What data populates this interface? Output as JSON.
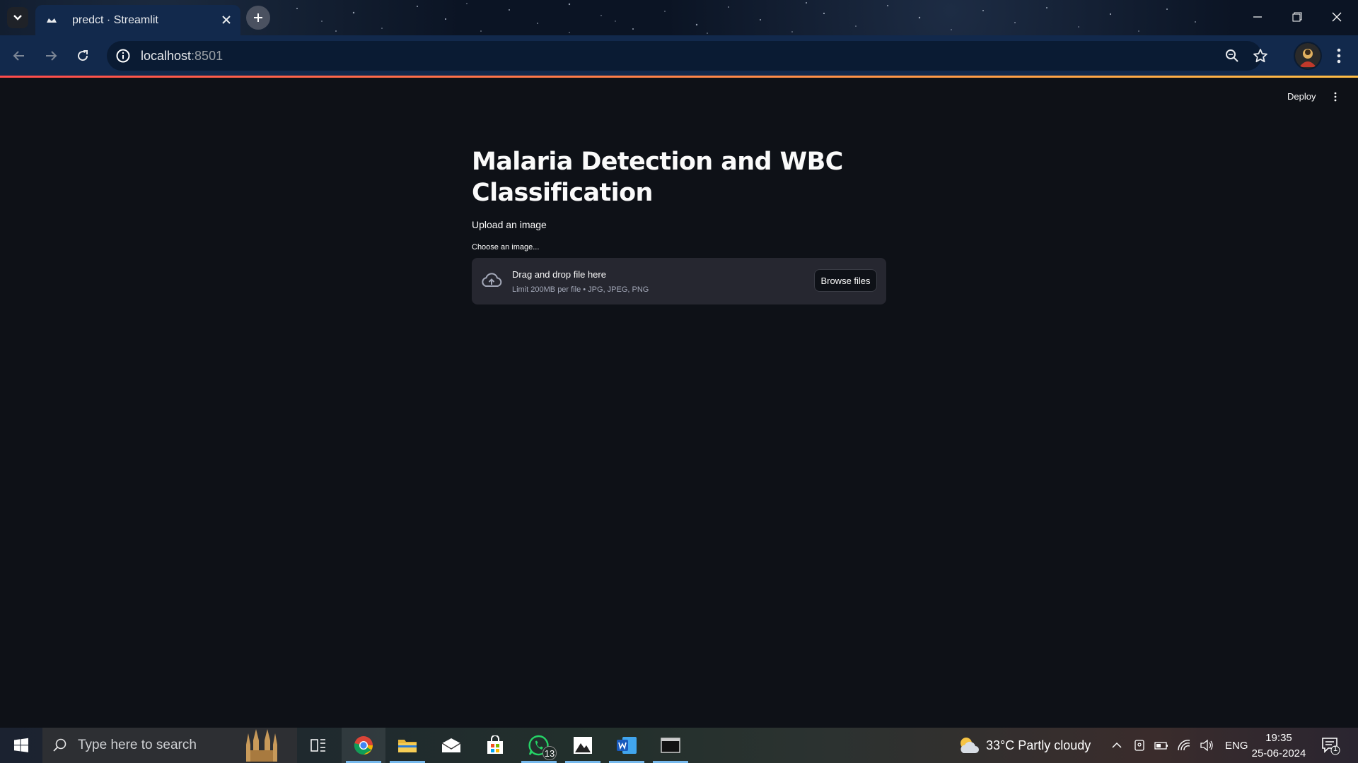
{
  "browser": {
    "tab_title": "predct · Streamlit",
    "url_host": "localhost",
    "url_port": ":8501"
  },
  "app": {
    "deploy_label": "Deploy",
    "title": "Malaria Detection and WBC Classification",
    "subheader": "Upload an image",
    "uploader": {
      "label": "Choose an image...",
      "drop_text": "Drag and drop file here",
      "limit_text": "Limit 200MB per file • JPG, JPEG, PNG",
      "browse_label": "Browse files"
    },
    "colors": {
      "background": "#0e1117",
      "dropzone": "#262730",
      "accent_start": "#ff4b4b",
      "accent_end": "#ffbd45"
    }
  },
  "taskbar": {
    "search_placeholder": "Type here to search",
    "apps": [
      "task-view",
      "chrome",
      "file-explorer",
      "mail",
      "microsoft-store",
      "whatsapp",
      "photos",
      "word",
      "terminal"
    ],
    "whatsapp_badge": "13",
    "weather": "33°C  Partly cloudy",
    "language": "ENG",
    "time": "19:35",
    "date": "25-06-2024",
    "notification_count": "1"
  }
}
